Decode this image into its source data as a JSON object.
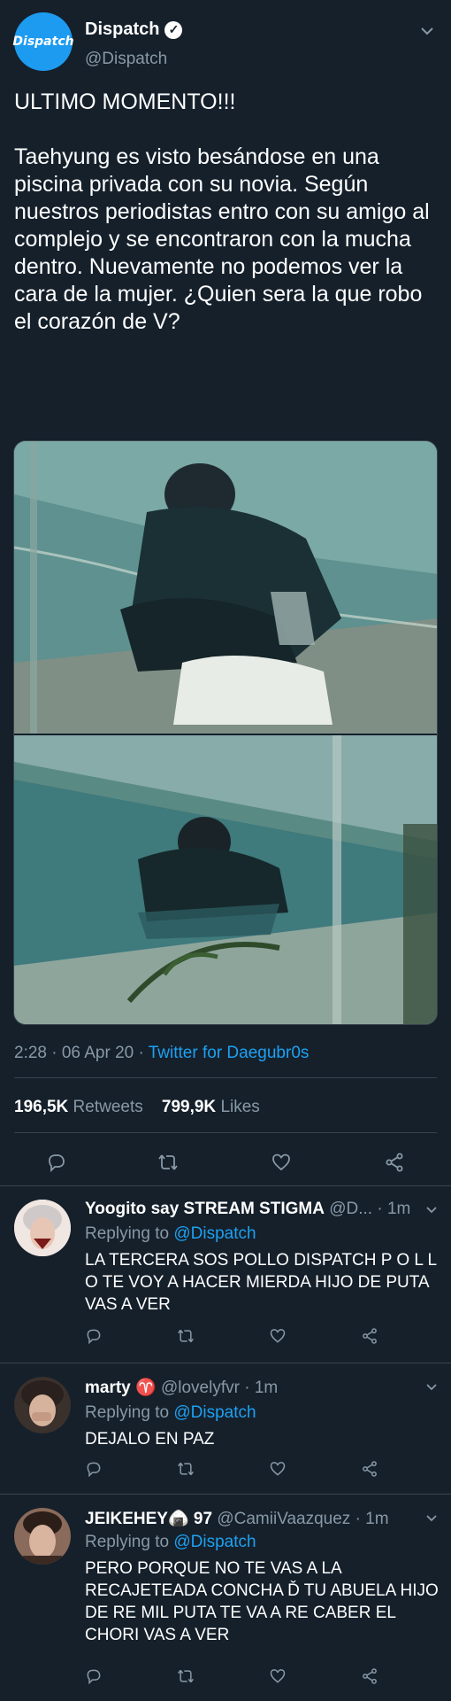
{
  "tweet": {
    "avatar_text": "Dispatch",
    "name": "Dispatch",
    "handle": "@Dispatch",
    "text": "ULTIMO MOMENTO!!!\n\nTaehyung es visto besándose en una piscina privada con su novia. Según nuestros periodistas entro con su amigo al complejo y se encontraron con la mucha dentro. Nuevamente no podemos ver la cara de la mujer. ¿Quien sera la que robo el corazón de V?",
    "time": "2:28 · 06 Apr 20 · ",
    "source": "Twitter for Daegubr0s",
    "retweets_count": "196,5K",
    "retweets_label": " Retweets",
    "likes_count": "799,9K",
    "likes_label": " Likes"
  },
  "replies": [
    {
      "name": "Yoogito say STREAM STIGMA",
      "handle": " @D... · 1m",
      "replying_prefix": "Replying to ",
      "replying_handle": "@Dispatch",
      "text": "LA TERCERA SOS POLLO DISPATCH P O L L O TE VOY A HACER MIERDA HIJO DE PUTA VAS A VER"
    },
    {
      "name": "marty ",
      "name_symbol": "♈",
      "handle": " @lovelyfvr · 1m",
      "replying_prefix": "Replying to ",
      "replying_handle": "@Dispatch",
      "text": "DEJALO EN PAZ"
    },
    {
      "name": "JEIKEHEY",
      "name_emoji": "🍙",
      "name_suffix": " 97",
      "handle": " @CamiiVaazquez · 1m",
      "replying_prefix": "Replying to ",
      "replying_handle": "@Dispatch",
      "text": "PERO PORQUE NO TE VAS A LA RECAJETEADA CONCHA Ď TU ABUELA HIJO DE RE MIL PUTA TE VA A RE CABER EL CHORI VAS A VER"
    }
  ],
  "colors": {
    "background": "#15202b",
    "muted": "#8899a6",
    "link": "#1da1f2",
    "divider": "#38444d"
  },
  "icons": [
    "verified-icon",
    "chevron-down-icon",
    "reply-icon",
    "retweet-icon",
    "like-icon",
    "share-icon"
  ]
}
